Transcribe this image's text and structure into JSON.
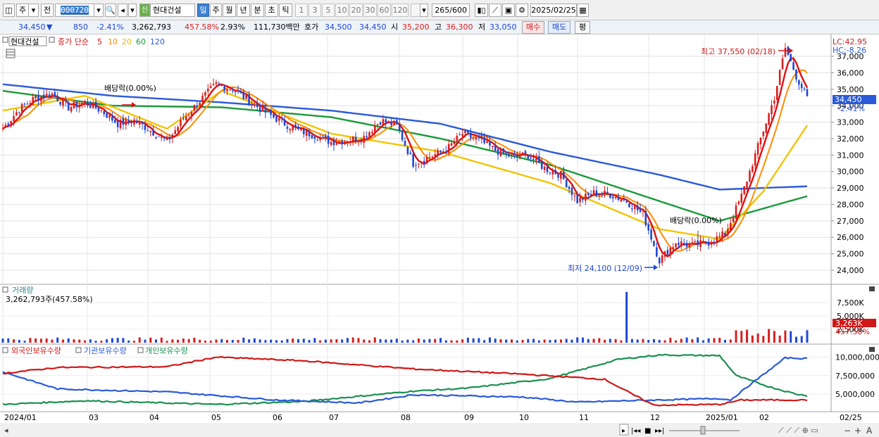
{
  "toolbar": {
    "period": "주",
    "prev": "전",
    "code": "000720",
    "stock_badge": "신",
    "stock_name": "현대건설",
    "intervals": [
      "일",
      "주",
      "월",
      "년",
      "분",
      "초",
      "틱"
    ],
    "selected_interval": "일",
    "ticks": [
      "1",
      "3",
      "5",
      "10",
      "20",
      "30",
      "60",
      "120"
    ],
    "count": "265",
    "max_count": "/600",
    "date": "2025/02/25"
  },
  "quote": {
    "price": "34,450",
    "change": "850",
    "change_pct": "-2.41%",
    "volume": "3,262,793",
    "volume_ratio": "457.58%",
    "turnover_pct": "2.93%",
    "amount": "111,730백만",
    "bid_label": "호가",
    "bid": "34,500",
    "ask": "34,450",
    "open_label": "시",
    "open": "35,200",
    "high_label": "고",
    "high": "36,300",
    "low_label": "저",
    "low": "33,050",
    "buy": "매수",
    "sell": "매도",
    "flat": "평"
  },
  "legend": {
    "stock": "현대건설",
    "close_label": "종가 단순",
    "ma_periods": [
      "5",
      "10",
      "20",
      "60",
      "120"
    ],
    "ma_colors": [
      "#e01010",
      "#ff8c00",
      "#f0c400",
      "#1a9a3a",
      "#2a5ad8"
    ]
  },
  "annotations": {
    "lc": "LC:42.95",
    "hc": "HC:-8.26",
    "high_note": "최고 37,550 (02/18)",
    "low_note": "최저 24,100 (12/09)",
    "dividend1": "배당락(0.00%)",
    "dividend2": "배당락(0.00%)",
    "price_tag": "34,450",
    "price_tag_pct": "-2.41%"
  },
  "volume_panel": {
    "title": "거래량",
    "value": "3,262,793주(457.58%)",
    "tag": "3,263K",
    "tag_pct": "457.58%"
  },
  "holdings_panel": {
    "series": [
      "외국인보유수량",
      "기관보유수량",
      "개인보유수량"
    ],
    "colors": [
      "#d01818",
      "#2a5ad8",
      "#1a9050"
    ]
  },
  "chart_data": {
    "type": "candlestick",
    "price_axis": {
      "ticks": [
        "37,000",
        "36,000",
        "35,000",
        "34,000",
        "33,000",
        "32,000",
        "31,000",
        "30,000",
        "29,000",
        "28,000",
        "27,000",
        "26,000",
        "25,000",
        "24,000"
      ],
      "ylim": [
        24000,
        37000
      ]
    },
    "volume_axis": {
      "ticks": [
        "7,500K",
        "5,000K",
        "2,500K"
      ]
    },
    "holdings_axis": {
      "ticks": [
        "10,000,000",
        "7,500,000",
        "5,000,000"
      ]
    },
    "x_axis": {
      "labels": [
        "2024/01",
        "03",
        "04",
        "05",
        "06",
        "07",
        "08",
        "09",
        "10",
        "11",
        "12",
        "2025/01",
        "02",
        "02/25"
      ]
    },
    "close_points": [
      [
        0,
        32600
      ],
      [
        6,
        33800
      ],
      [
        12,
        34500
      ],
      [
        18,
        34700
      ],
      [
        24,
        33900
      ],
      [
        30,
        34200
      ],
      [
        36,
        33700
      ],
      [
        42,
        32900
      ],
      [
        48,
        33100
      ],
      [
        54,
        32500
      ],
      [
        60,
        31800
      ],
      [
        66,
        33200
      ],
      [
        72,
        34300
      ],
      [
        78,
        35300
      ],
      [
        84,
        35000
      ],
      [
        90,
        34300
      ],
      [
        96,
        33600
      ],
      [
        102,
        33000
      ],
      [
        108,
        32500
      ],
      [
        114,
        32200
      ],
      [
        120,
        31800
      ],
      [
        126,
        31900
      ],
      [
        132,
        32100
      ],
      [
        138,
        33100
      ],
      [
        144,
        32800
      ],
      [
        150,
        30500
      ],
      [
        156,
        30900
      ],
      [
        162,
        31300
      ],
      [
        168,
        32300
      ],
      [
        174,
        31900
      ],
      [
        180,
        31300
      ],
      [
        186,
        30900
      ],
      [
        192,
        31000
      ],
      [
        198,
        30200
      ],
      [
        204,
        29800
      ],
      [
        210,
        28200
      ],
      [
        216,
        28700
      ],
      [
        222,
        28600
      ],
      [
        228,
        28200
      ],
      [
        234,
        27400
      ],
      [
        240,
        24600
      ],
      [
        246,
        25700
      ],
      [
        252,
        25500
      ],
      [
        258,
        25700
      ],
      [
        264,
        26200
      ],
      [
        270,
        28500
      ],
      [
        276,
        31500
      ],
      [
        282,
        34500
      ],
      [
        286,
        37500
      ],
      [
        290,
        35800
      ],
      [
        294,
        34450
      ]
    ],
    "ma_series": [
      {
        "name": "120",
        "points": [
          [
            0,
            35300
          ],
          [
            40,
            34600
          ],
          [
            80,
            34200
          ],
          [
            120,
            33700
          ],
          [
            160,
            32900
          ],
          [
            200,
            31200
          ],
          [
            240,
            29800
          ],
          [
            262,
            28900
          ],
          [
            294,
            29100
          ]
        ]
      },
      {
        "name": "60",
        "points": [
          [
            0,
            34900
          ],
          [
            40,
            34000
          ],
          [
            80,
            33900
          ],
          [
            120,
            33300
          ],
          [
            160,
            32000
          ],
          [
            200,
            30400
          ],
          [
            240,
            28200
          ],
          [
            262,
            27000
          ],
          [
            294,
            28500
          ]
        ]
      },
      {
        "name": "20",
        "points": [
          [
            0,
            33700
          ],
          [
            30,
            34600
          ],
          [
            60,
            32600
          ],
          [
            80,
            34900
          ],
          [
            120,
            32300
          ],
          [
            160,
            31200
          ],
          [
            200,
            29300
          ],
          [
            240,
            26500
          ],
          [
            262,
            25900
          ],
          [
            278,
            28800
          ],
          [
            294,
            32800
          ]
        ]
      }
    ],
    "volume_spike": {
      "x": 228,
      "value": 9500
    },
    "holdings": {
      "foreign_start": 7800000,
      "institution_start": 8000000,
      "individual_start": 3600000
    }
  }
}
